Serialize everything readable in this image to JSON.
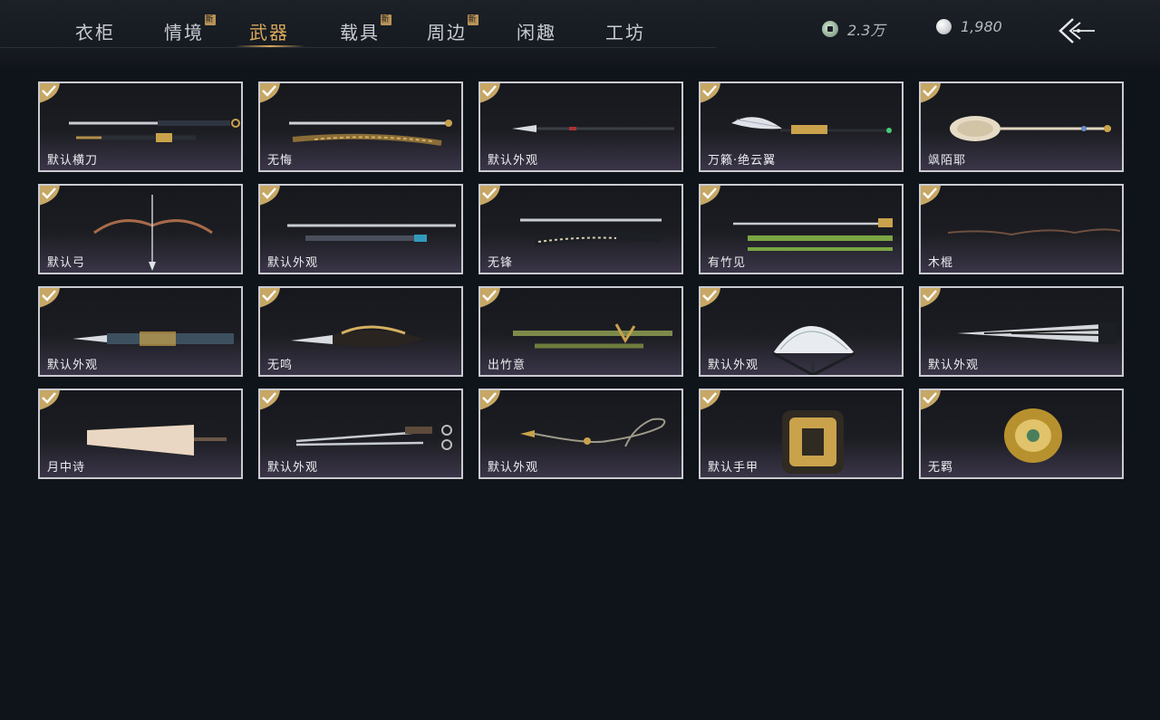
{
  "tabs": [
    {
      "label": "衣柜",
      "badge": ""
    },
    {
      "label": "情境",
      "badge": "新"
    },
    {
      "label": "武器",
      "badge": ""
    },
    {
      "label": "载具",
      "badge": "新"
    },
    {
      "label": "周边",
      "badge": "新"
    },
    {
      "label": "闲趣",
      "badge": ""
    },
    {
      "label": "工坊",
      "badge": ""
    }
  ],
  "active_tab": "武器",
  "currency": {
    "jade": {
      "icon": "jade-coin-icon",
      "value": "2.3万"
    },
    "pearl": {
      "icon": "pearl-icon",
      "value": "1,980"
    }
  },
  "items": [
    {
      "name": "默认横刀",
      "art": "dao",
      "owned": true
    },
    {
      "name": "无悔",
      "art": "dao-gold",
      "owned": true
    },
    {
      "name": "默认外观",
      "art": "spear",
      "owned": true
    },
    {
      "name": "万籁·绝云翼",
      "art": "wing-spear",
      "owned": true
    },
    {
      "name": "飒陌耶",
      "art": "mirror-staff",
      "owned": true
    },
    {
      "name": "默认弓",
      "art": "bow",
      "owned": true
    },
    {
      "name": "默认外观",
      "art": "twin-sword",
      "owned": true
    },
    {
      "name": "无锋",
      "art": "sword-dark",
      "owned": true
    },
    {
      "name": "有竹见",
      "art": "bamboo-sword",
      "owned": true
    },
    {
      "name": "木棍",
      "art": "stick",
      "owned": true
    },
    {
      "name": "默认外观",
      "art": "blade-set",
      "owned": true
    },
    {
      "name": "无鸣",
      "art": "gold-blades",
      "owned": true
    },
    {
      "name": "出竹意",
      "art": "bamboo-staff",
      "owned": true
    },
    {
      "name": "默认外观",
      "art": "fan",
      "owned": true
    },
    {
      "name": "默认外观",
      "art": "closed-fan",
      "owned": true
    },
    {
      "name": "月中诗",
      "art": "umbrella",
      "owned": true
    },
    {
      "name": "默认外观",
      "art": "dual-dao",
      "owned": true
    },
    {
      "name": "默认外观",
      "art": "rope-dart",
      "owned": true
    },
    {
      "name": "默认手甲",
      "art": "gauntlet",
      "owned": true
    },
    {
      "name": "无羁",
      "art": "gold-gauntlet",
      "owned": true
    }
  ]
}
